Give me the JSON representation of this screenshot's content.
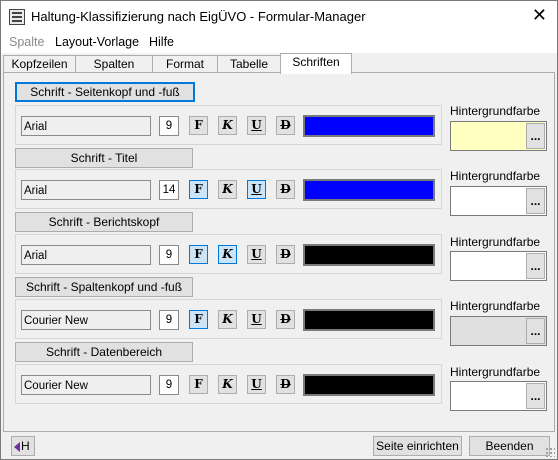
{
  "window": {
    "title": "Haltung-Klassifizierung nach EigÜVO - Formular-Manager"
  },
  "menu": [
    {
      "label": "Spalte",
      "disabled": true
    },
    {
      "label": "Layout-Vorlage",
      "disabled": false
    },
    {
      "label": "Hilfe",
      "disabled": false
    }
  ],
  "tabs": [
    {
      "label": "Kopfzeilen",
      "active": false
    },
    {
      "label": "Spalten",
      "active": false
    },
    {
      "label": "Format",
      "active": false
    },
    {
      "label": "Tabelle",
      "active": false
    },
    {
      "label": "Schriften",
      "active": true
    }
  ],
  "style_glyphs": {
    "bold": "F",
    "italic": "K",
    "underline": "U",
    "strike": "D"
  },
  "background_label": "Hintergrundfarbe",
  "dots_label": "...",
  "groups": [
    {
      "label": "Schrift - Seitenkopf und -fuß",
      "font": "Arial",
      "size": "9",
      "bold": false,
      "italic": false,
      "underline": false,
      "strike": false,
      "color": "#0000ff",
      "background": "#ffffc0"
    },
    {
      "label": "Schrift - Titel",
      "font": "Arial",
      "size": "14",
      "bold": true,
      "italic": false,
      "underline": true,
      "strike": false,
      "color": "#0000ff",
      "background": "#ffffff"
    },
    {
      "label": "Schrift - Berichtskopf",
      "font": "Arial",
      "size": "9",
      "bold": true,
      "italic": true,
      "underline": false,
      "strike": false,
      "color": "#000000",
      "background": "#ffffff"
    },
    {
      "label": "Schrift - Spaltenkopf und -fuß",
      "font": "Courier New",
      "size": "9",
      "bold": true,
      "italic": false,
      "underline": false,
      "strike": false,
      "color": "#000000",
      "background": "#e0e0e0"
    },
    {
      "label": "Schrift - Datenbereich",
      "font": "Courier New",
      "size": "9",
      "bold": false,
      "italic": false,
      "underline": false,
      "strike": false,
      "color": "#000000",
      "background": "#ffffff"
    }
  ],
  "bottom": {
    "help_label": "H",
    "page_setup": "Seite einrichten",
    "close": "Beenden"
  }
}
